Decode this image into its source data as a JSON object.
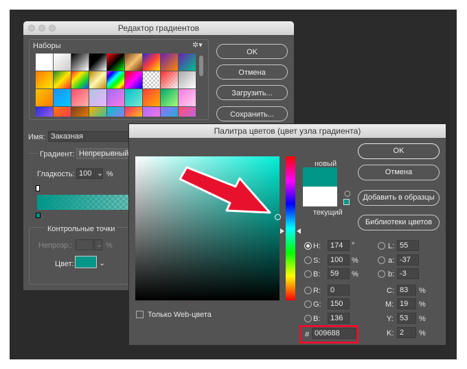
{
  "gradient_editor": {
    "title": "Редактор градиентов",
    "presets_label": "Наборы",
    "buttons": {
      "ok": "OK",
      "cancel": "Отмена",
      "load": "Загрузить...",
      "save": "Сохранить..."
    },
    "name_label": "Имя:",
    "name_value": "Заказная",
    "gradient_type_label": "Градиент:",
    "gradient_type_value": "Непрерывный",
    "smoothness_label": "Гладкость:",
    "smoothness_value": "100",
    "smoothness_unit": "%",
    "stops_group_label": "Контрольные точки",
    "opacity_label": "Непрозр.:",
    "opacity_unit": "%",
    "color_label": "Цвет:",
    "stop_color": "#009688"
  },
  "color_picker": {
    "title": "Палитра цветов (цвет узла градиента)",
    "new_label": "новый",
    "current_label": "текущий",
    "new_color": "#009688",
    "current_color": "#ffffff",
    "buttons": {
      "ok": "OK",
      "cancel": "Отмена",
      "add_swatch": "Добавить в образцы",
      "libraries": "Библиотеки цветов"
    },
    "hsb": {
      "h_label": "H:",
      "h_value": "174",
      "h_unit": "°",
      "s_label": "S:",
      "s_value": "100",
      "s_unit": "%",
      "b_label": "B:",
      "b_value": "59",
      "b_unit": "%"
    },
    "rgb": {
      "r_label": "R:",
      "r_value": "0",
      "g_label": "G:",
      "g_value": "150",
      "b_label": "B:",
      "b_value": "136"
    },
    "lab": {
      "l_label": "L:",
      "l_value": "55",
      "a_label": "a:",
      "a_value": "-37",
      "b_label": "b:",
      "b_value": "-3"
    },
    "cmyk": {
      "c_label": "C:",
      "c_value": "83",
      "c_unit": "%",
      "m_label": "M:",
      "m_value": "19",
      "m_unit": "%",
      "y_label": "Y:",
      "y_value": "53",
      "y_unit": "%",
      "k_label": "K:",
      "k_value": "2",
      "k_unit": "%"
    },
    "hex_label": "#",
    "hex_value": "009688",
    "web_only_label": "Только Web-цвета"
  },
  "colors": {
    "annotation_red": "#e8112d",
    "accent": "#009688"
  }
}
